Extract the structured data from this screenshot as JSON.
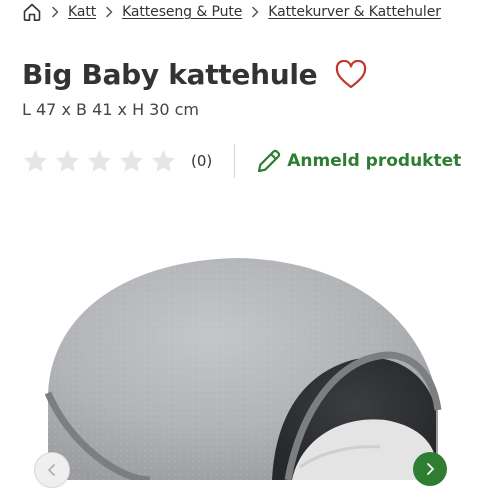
{
  "breadcrumb": {
    "home_icon": "home-icon",
    "items": [
      "Katt",
      "Katteseng & Pute",
      "Kattekurver & Kattehuler"
    ]
  },
  "product": {
    "title": "Big Baby kattehule",
    "dimensions": "L 47 x B 41 x H 30 cm",
    "favorite_icon": "heart-outline-icon"
  },
  "rating": {
    "stars_filled": 0,
    "stars_total": 5,
    "count": "(0)",
    "review_button_label": "Anmeld produktet",
    "review_icon": "pencil-icon"
  },
  "gallery": {
    "image_subject": "grey felt cat cave",
    "prev_icon": "chevron-left-icon",
    "next_icon": "chevron-right-icon"
  },
  "colors": {
    "accent_green": "#2e7d32",
    "heart_red": "#c0392b",
    "star_empty": "#e6e6e6",
    "text_dark": "#333333"
  }
}
